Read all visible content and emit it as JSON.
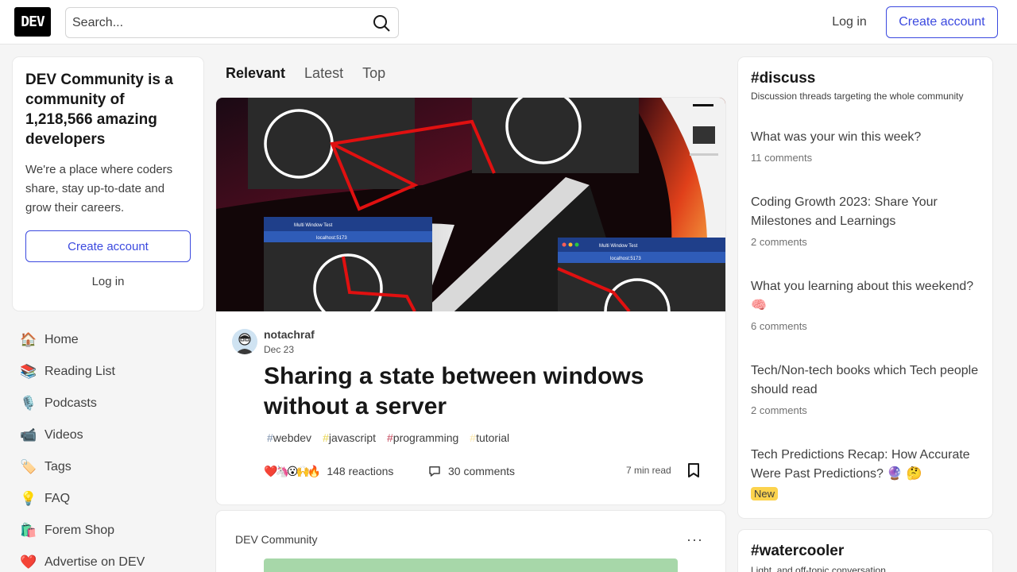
{
  "header": {
    "logo": "DEV",
    "search_placeholder": "Search...",
    "login_label": "Log in",
    "create_account_label": "Create account"
  },
  "intro": {
    "title": "DEV Community is a community of 1,218,566 amazing developers",
    "text": "We're a place where coders share, stay up-to-date and grow their careers.",
    "create_account_label": "Create account",
    "login_label": "Log in"
  },
  "nav": {
    "items": [
      {
        "label": "Home",
        "icon": "house-icon"
      },
      {
        "label": "Reading List",
        "icon": "reading-list-icon"
      },
      {
        "label": "Podcasts",
        "icon": "microphone-icon"
      },
      {
        "label": "Videos",
        "icon": "video-camera-icon"
      },
      {
        "label": "Tags",
        "icon": "tag-icon"
      },
      {
        "label": "FAQ",
        "icon": "lightbulb-icon"
      },
      {
        "label": "Forem Shop",
        "icon": "shopping-bags-icon"
      },
      {
        "label": "Advertise on DEV",
        "icon": "heart-icon"
      }
    ]
  },
  "feed": {
    "tabs": [
      "Relevant",
      "Latest",
      "Top"
    ],
    "active_tab": "Relevant"
  },
  "article": {
    "author": "notachraf",
    "date": "Dec 23",
    "title": "Sharing a state between windows without a server",
    "tags": [
      "webdev",
      "javascript",
      "programming",
      "tutorial"
    ],
    "reaction_emojis": [
      "❤️",
      "🦄",
      "😮",
      "🙌",
      "🔥"
    ],
    "reactions_label": "148 reactions",
    "comments_label": "30 comments",
    "read_time": "7 min read",
    "cover_window_title": "Multi Window Test",
    "cover_window_url": "localhost:5173"
  },
  "article2": {
    "org": "DEV Community",
    "more_label": "···"
  },
  "discuss": {
    "title": "#discuss",
    "subtitle": "Discussion threads targeting the whole community",
    "items": [
      {
        "title": "What was your win this week?",
        "comments": "11 comments"
      },
      {
        "title": "Coding Growth 2023: Share Your Milestones and Learnings",
        "comments": "2 comments"
      },
      {
        "title": "What you learning about this weekend? 🧠",
        "comments": "6 comments"
      },
      {
        "title": "Tech/Non-tech books which Tech people should read",
        "comments": "2 comments"
      },
      {
        "title": "Tech Predictions Recap: How Accurate Were Past Predictions? 🔮 🤔",
        "badge": "New"
      }
    ]
  },
  "watercooler": {
    "title": "#watercooler",
    "subtitle": "Light, and off-topic conversation"
  },
  "colors": {
    "accent": "#3b49df",
    "page_bg": "#f5f5f5",
    "new_badge": "#fcd34d"
  }
}
